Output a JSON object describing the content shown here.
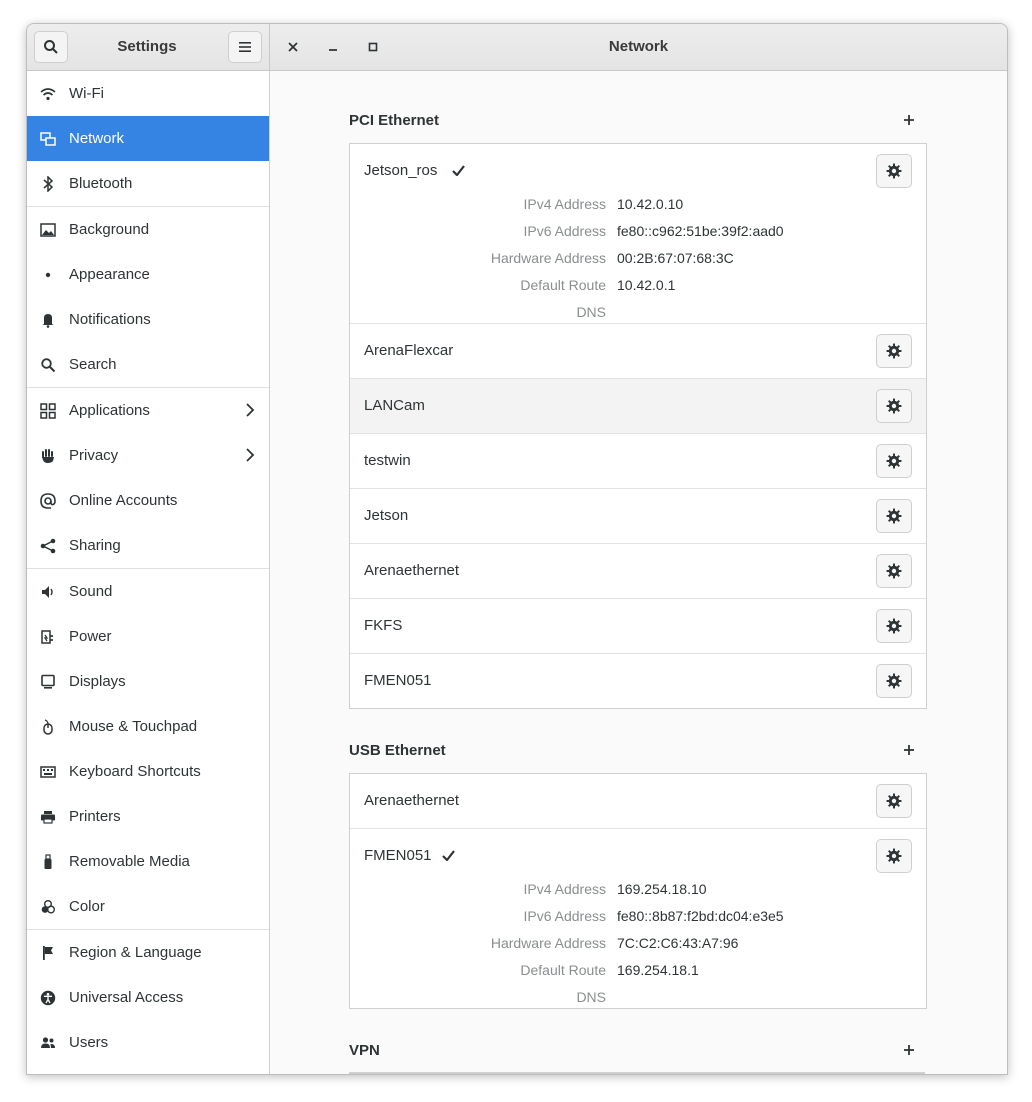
{
  "header": {
    "app_title": "Settings",
    "page_title": "Network"
  },
  "sidebar": {
    "items": [
      {
        "label": "Wi-Fi"
      },
      {
        "label": "Network"
      },
      {
        "label": "Bluetooth"
      },
      {
        "label": "Background"
      },
      {
        "label": "Appearance"
      },
      {
        "label": "Notifications"
      },
      {
        "label": "Search"
      },
      {
        "label": "Applications"
      },
      {
        "label": "Privacy"
      },
      {
        "label": "Online Accounts"
      },
      {
        "label": "Sharing"
      },
      {
        "label": "Sound"
      },
      {
        "label": "Power"
      },
      {
        "label": "Displays"
      },
      {
        "label": "Mouse & Touchpad"
      },
      {
        "label": "Keyboard Shortcuts"
      },
      {
        "label": "Printers"
      },
      {
        "label": "Removable Media"
      },
      {
        "label": "Color"
      },
      {
        "label": "Region & Language"
      },
      {
        "label": "Universal Access"
      },
      {
        "label": "Users"
      }
    ]
  },
  "pci": {
    "title": "PCI Ethernet",
    "connections": [
      {
        "name": "Jetson_ros"
      },
      {
        "name": "ArenaFlexcar"
      },
      {
        "name": "LANCam"
      },
      {
        "name": "testwin"
      },
      {
        "name": "Jetson"
      },
      {
        "name": "Arenaethernet"
      },
      {
        "name": "FKFS"
      },
      {
        "name": "FMEN051"
      }
    ],
    "details": {
      "ipv4_label": "IPv4 Address",
      "ipv4": "10.42.0.10",
      "ipv6_label": "IPv6 Address",
      "ipv6": "fe80::c962:51be:39f2:aad0",
      "hw_label": "Hardware Address",
      "hw": "00:2B:67:07:68:3C",
      "route_label": "Default Route",
      "route": "10.42.0.1",
      "dns_label": "DNS",
      "dns": ""
    }
  },
  "usb": {
    "title": "USB Ethernet",
    "connections": [
      {
        "name": "Arenaethernet"
      },
      {
        "name": "FMEN051"
      }
    ],
    "details": {
      "ipv4_label": "IPv4 Address",
      "ipv4": "169.254.18.10",
      "ipv6_label": "IPv6 Address",
      "ipv6": "fe80::8b87:f2bd:dc04:e3e5",
      "hw_label": "Hardware Address",
      "hw": "7C:C2:C6:43:A7:96",
      "route_label": "Default Route",
      "route": "169.254.18.1",
      "dns_label": "DNS",
      "dns": ""
    }
  },
  "vpn": {
    "title": "VPN"
  },
  "colors": {
    "accent": "#3584e4"
  }
}
